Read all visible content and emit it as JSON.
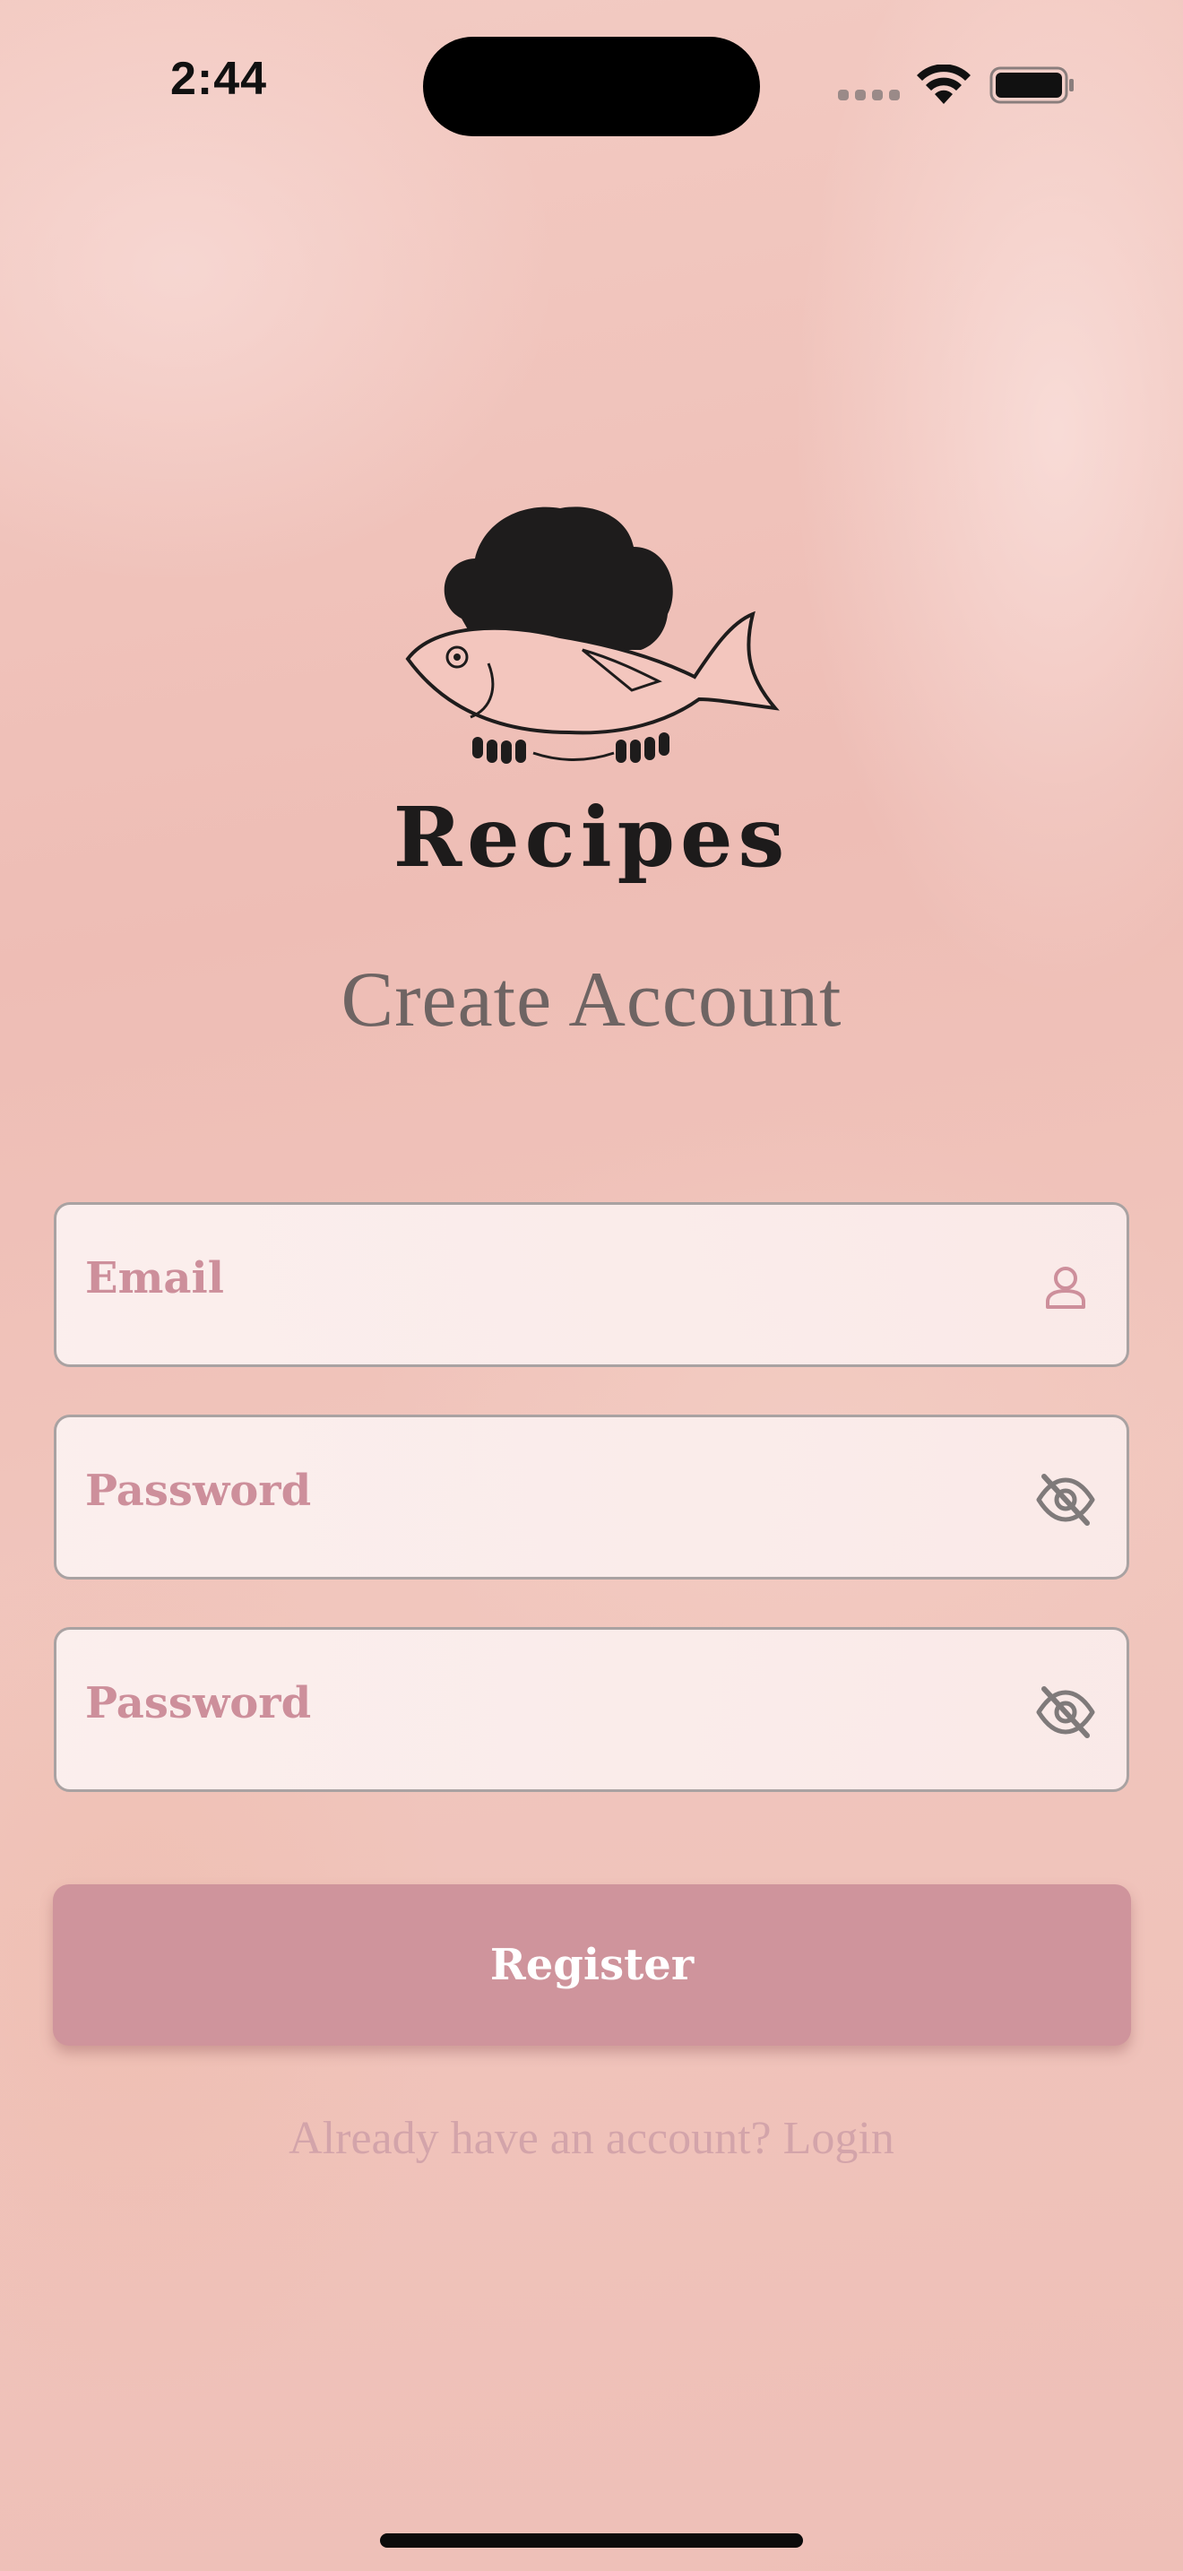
{
  "status_bar": {
    "time": "2:44"
  },
  "brand": {
    "name": "Recipes",
    "logo_icon": "chef-hat-fish-icon"
  },
  "page": {
    "title": "Create Account"
  },
  "form": {
    "email": {
      "placeholder": "Email",
      "value": "",
      "icon": "user-icon"
    },
    "password": {
      "placeholder": "Password",
      "value": "",
      "icon": "eye-off-icon"
    },
    "confirm_password": {
      "placeholder": "Password",
      "value": "",
      "icon": "eye-off-icon"
    }
  },
  "actions": {
    "register_label": "Register",
    "login_prompt": "Already have an account? Login"
  },
  "colors": {
    "accent": "#cf949c",
    "placeholder": "#cd8f9b",
    "heading": "#6e6463",
    "link": "#d3a4aa"
  }
}
